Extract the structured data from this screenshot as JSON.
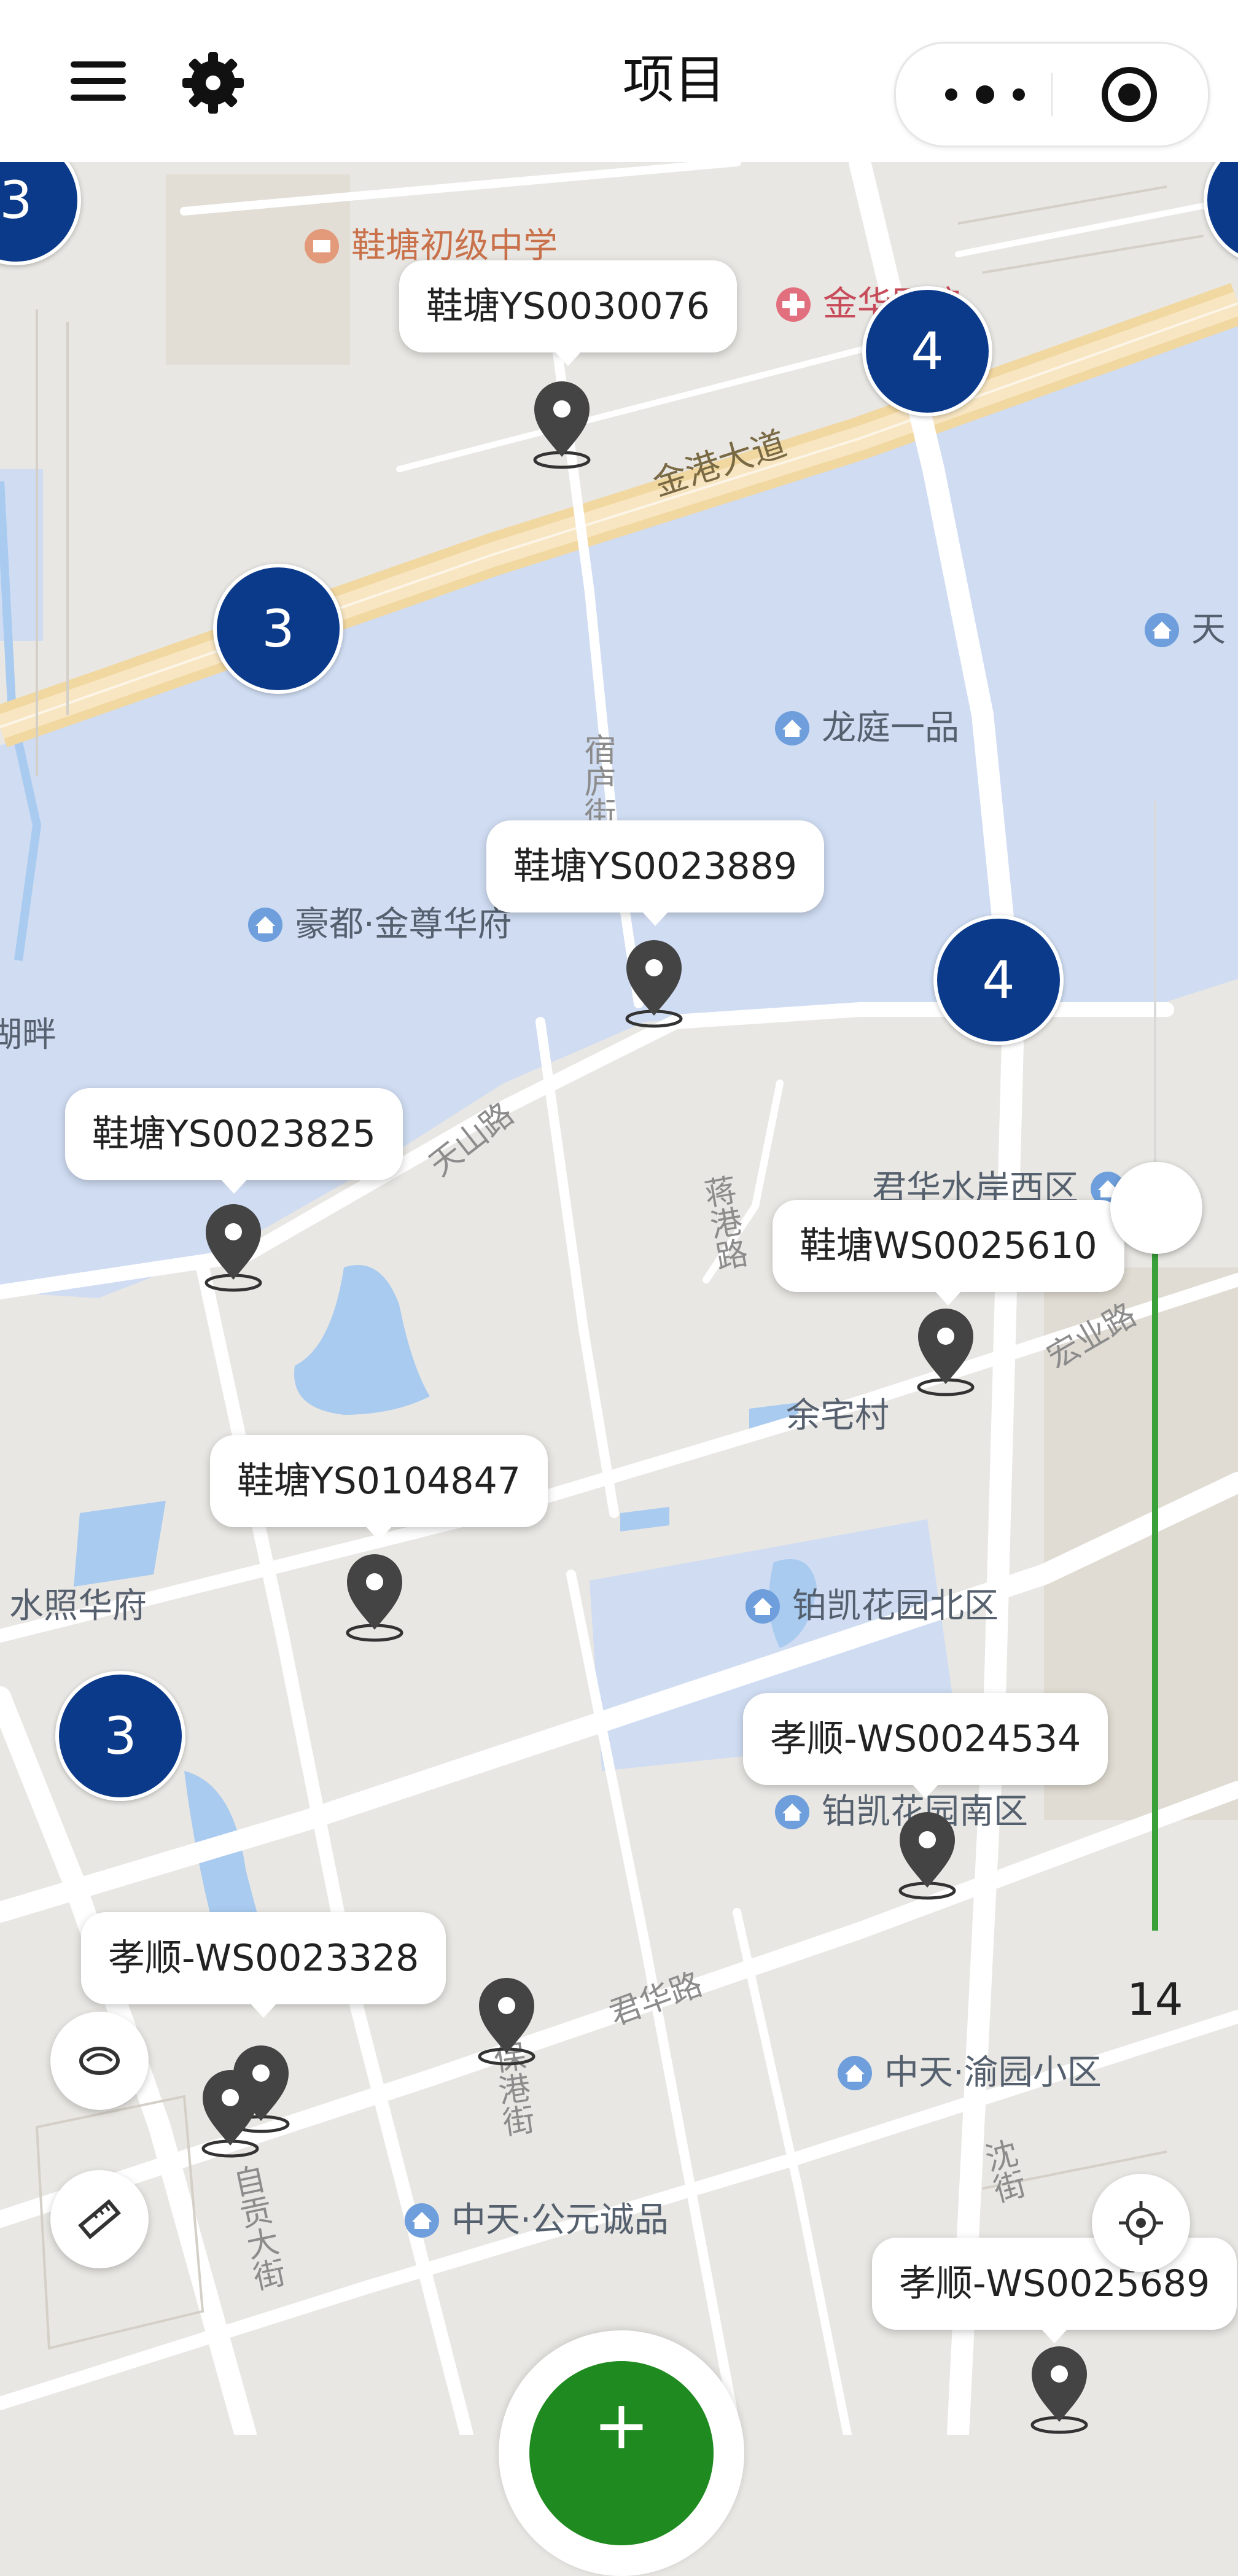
{
  "header": {
    "title": "项目",
    "icons": [
      "menu-icon",
      "settings-icon",
      "more-icon",
      "target-icon"
    ]
  },
  "map_labels": {
    "school": "鞋塘初级中学",
    "hospital": "金华医院",
    "road_jingang": "金港大道",
    "road_tianshan": "天山路",
    "road_jishan": "蒋港路",
    "road_hongye": "宏业路",
    "road_junhua": "君华路",
    "road_zigong": "自贡大街",
    "road_xiangyuan": "宿庐街",
    "road_lower_right": "沈街",
    "road_baojie": "保港街",
    "longting": "龙庭一品",
    "haodu": "豪都·金尊华府",
    "junhua_west": "君华水岸西区",
    "yuzhai": "余宅村",
    "bokai_north": "铂凯花园北区",
    "bokai_south": "铂凯花园南区",
    "zhongtian_yu": "中天·渝园小区",
    "zhongtian_gongyuan": "中天·公元诚品",
    "shuizhao": "水照华府",
    "tian_partial": "天",
    "left_partial": "湖畔"
  },
  "clusters": [
    "3",
    "4",
    "3",
    "4",
    "3"
  ],
  "markers": [
    "鞋塘YS0030076",
    "鞋塘YS0023889",
    "鞋塘YS0023825",
    "鞋塘WS0025610",
    "鞋塘YS0104847",
    "孝顺-WS0024534",
    "孝顺-WS0023328",
    "孝顺-WS0025689"
  ],
  "zoom": {
    "level": "14"
  },
  "colors": {
    "cluster": "#0b3a8a",
    "water": "#cfdcf2",
    "land": "#e9e7e3",
    "highway": "#f6dca4",
    "zoom_fill": "#3aa13a",
    "center_button": "#1f8a1f"
  },
  "floating_buttons": [
    "layer-icon",
    "ruler-icon",
    "locate-icon",
    "add-button"
  ],
  "center_button": {
    "label": "+"
  }
}
